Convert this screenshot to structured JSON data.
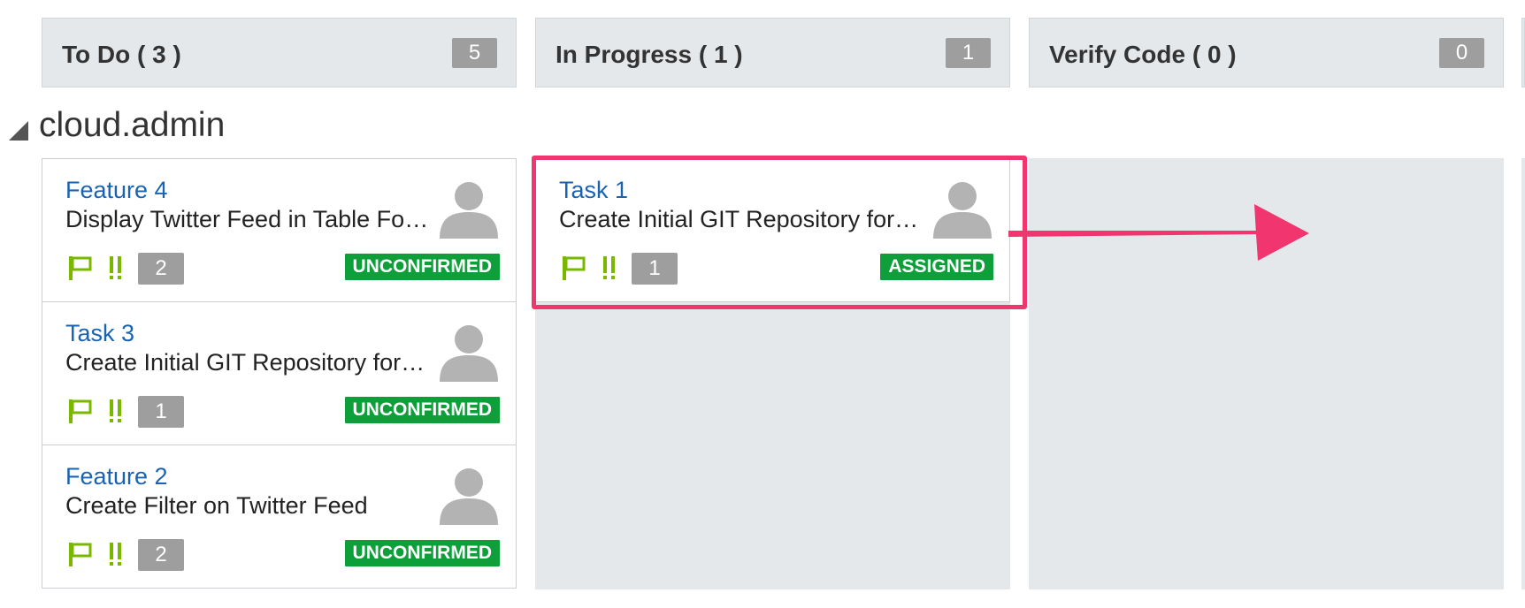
{
  "columns": [
    {
      "title": "To Do ( 3 )",
      "count": "5"
    },
    {
      "title": "In Progress ( 1 )",
      "count": "1"
    },
    {
      "title": "Verify Code ( 0 )",
      "count": "0"
    }
  ],
  "group": {
    "name": "cloud.admin",
    "collapse_icon": "triangle-down-icon"
  },
  "todo_cards": [
    {
      "title": "Feature 4",
      "description": "Display Twitter Feed in Table Format",
      "points": "2",
      "status": "UNCONFIRMED"
    },
    {
      "title": "Task 3",
      "description": "Create Initial GIT Repository for Project",
      "points": "1",
      "status": "UNCONFIRMED"
    },
    {
      "title": "Feature 2",
      "description": "Create Filter on Twitter Feed",
      "points": "2",
      "status": "UNCONFIRMED"
    }
  ],
  "in_progress_cards": [
    {
      "title": "Task 1",
      "description": "Create Initial GIT Repository for Project",
      "points": "1",
      "status": "ASSIGNED"
    }
  ],
  "icons": {
    "flag": "flag-icon",
    "priority": "double-exclamation-icon",
    "avatar": "user-avatar-icon"
  },
  "colors": {
    "link": "#1a63b0",
    "status_green": "#0e9e3a",
    "badge_gray": "#9e9e9e",
    "lane_bg": "#e4e8eb",
    "highlight": "#f0356f",
    "icon_green": "#7ab800"
  }
}
